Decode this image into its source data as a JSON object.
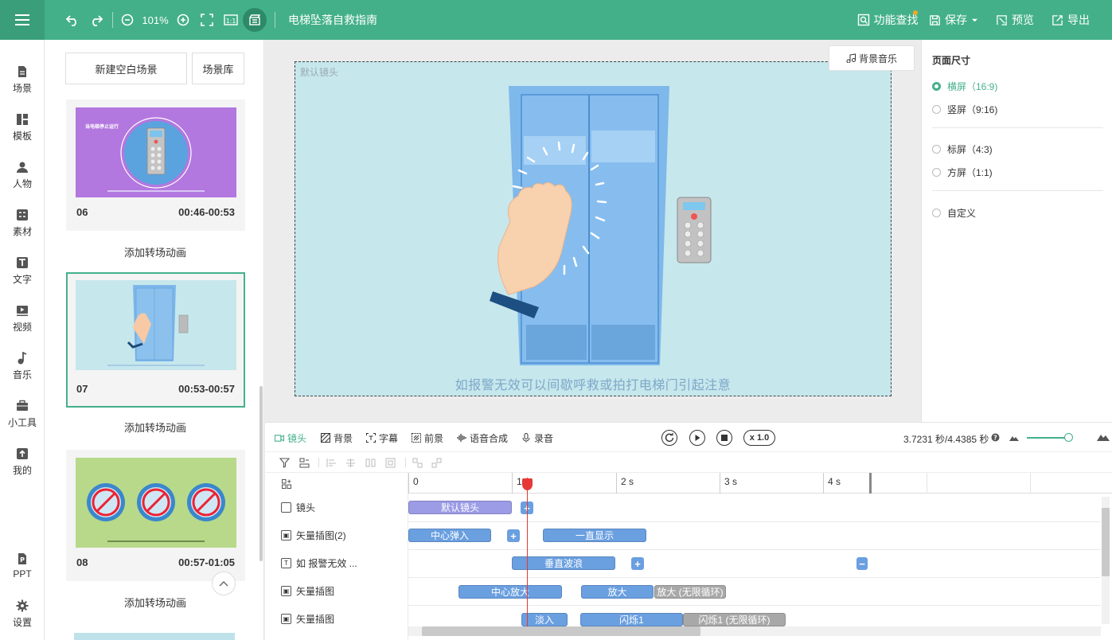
{
  "topbar": {
    "zoom": "101%",
    "doc_title": "电梯坠落自救指南",
    "func_search": "功能查找",
    "save": "保存",
    "preview": "预览",
    "export": "导出",
    "accent": "#43b08a"
  },
  "leftnav": {
    "items": [
      {
        "label": "场景",
        "icon": "scene-icon"
      },
      {
        "label": "模板",
        "icon": "template-icon"
      },
      {
        "label": "人物",
        "icon": "person-icon"
      },
      {
        "label": "素材",
        "icon": "material-icon"
      },
      {
        "label": "文字",
        "icon": "text-icon"
      },
      {
        "label": "视频",
        "icon": "video-icon"
      },
      {
        "label": "音乐",
        "icon": "music-icon"
      },
      {
        "label": "小工具",
        "icon": "toolbox-icon"
      },
      {
        "label": "我的",
        "icon": "upload-icon"
      },
      {
        "label": "PPT",
        "icon": "ppt-icon"
      },
      {
        "label": "设置",
        "icon": "gear-icon"
      }
    ]
  },
  "scenes": {
    "new_blank": "新建空白场景",
    "library": "场景库",
    "add_transition": "添加转场动画",
    "cards": [
      {
        "num": "06",
        "time": "00:46-00:53",
        "thumb_title": "当电梯停止运行"
      },
      {
        "num": "07",
        "time": "00:53-00:57"
      },
      {
        "num": "08",
        "time": "00:57-01:05"
      }
    ]
  },
  "stage": {
    "label": "默认镜头",
    "subtitle": "如报警无效可以间歇呼救或拍打电梯门引起注意",
    "bgm": "背景音乐"
  },
  "props": {
    "title": "页面尺寸",
    "options": [
      {
        "label": "横屏（16:9)",
        "selected": true
      },
      {
        "label": "竖屏（9:16)",
        "selected": false
      },
      {
        "label": "标屏（4:3)",
        "selected": false
      },
      {
        "label": "方屏（1:1)",
        "selected": false
      },
      {
        "label": "自定义",
        "selected": false
      }
    ]
  },
  "tltoolbar": {
    "tabs": [
      "镜头",
      "背景",
      "字幕",
      "前景",
      "语音合成",
      "录音"
    ],
    "speed": "x 1.0",
    "time": "3.7231 秒/4.4385 秒"
  },
  "timeline": {
    "ruler": [
      "0",
      "1 s",
      "2 s",
      "3 s",
      "4 s"
    ],
    "tracks": [
      "镜头",
      "矢量插图(2)",
      "如 报警无效 ...",
      "矢量插图",
      "矢量插图"
    ],
    "clips": {
      "r0": [
        "默认镜头"
      ],
      "r1": [
        "中心弹入",
        "一直显示"
      ],
      "r2": [
        "垂直波浪"
      ],
      "r3": [
        "中心放大",
        "放大",
        "放大 (无限循环)"
      ],
      "r4": [
        "淡入",
        "闪烁1",
        "闪烁1 (无限循环)"
      ]
    },
    "playhead_seconds": 3.7231
  }
}
